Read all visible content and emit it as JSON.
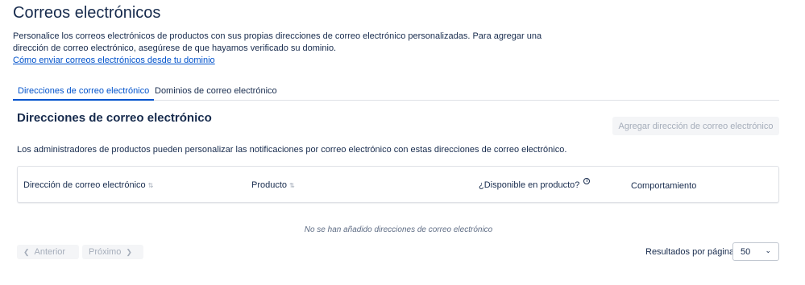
{
  "page": {
    "title": "Correos electrónicos",
    "intro": "Personalice los correos electrónicos de productos con sus propias direcciones de correo electrónico personalizadas. Para agregar una dirección de correo electrónico, asegúrese de que hayamos verificado su dominio.",
    "intro_link": "Cómo enviar correos electrónicos desde tu dominio"
  },
  "tabs": [
    {
      "label": "Direcciones de correo electrónico",
      "active": true
    },
    {
      "label": "Dominios de correo electrónico",
      "active": false
    }
  ],
  "section": {
    "title": "Direcciones de correo electrónico",
    "add_button": "Agregar dirección de correo electrónico",
    "description": "Los administradores de productos pueden personalizar las notificaciones por correo electrónico con estas direcciones de correo electrónico."
  },
  "table": {
    "columns": [
      "Dirección de correo electrónico",
      "Producto",
      "¿Disponible en producto?",
      "Comportamiento"
    ],
    "rows": [],
    "empty_message": "No se han añadido direcciones de correo electrónico"
  },
  "pagination": {
    "prev_label": "Anterior",
    "next_label": "Próximo",
    "results_label": "Resultados por página:",
    "results_value": "50"
  },
  "icons": {
    "info": "info-icon",
    "sort": "sort-icon",
    "prev": "chevron-left-icon",
    "next": "chevron-right-icon",
    "select": "chevron-down-icon"
  },
  "colors": {
    "link": "#0052cc",
    "text": "#172b4d",
    "disabled_text": "#a5adba",
    "disabled_bg": "#f4f5f7",
    "border": "#dfe1e6"
  }
}
